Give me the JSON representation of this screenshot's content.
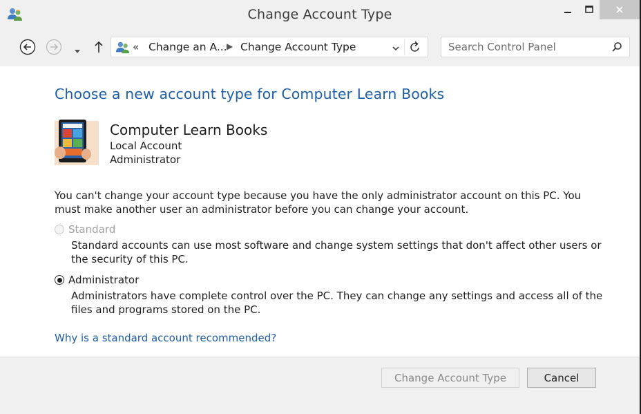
{
  "window": {
    "title": "Change Account Type",
    "app_icon": "users-icon",
    "controls": {
      "minimize": "minimize-icon",
      "maximize": "maximize-icon",
      "close": "close-icon"
    }
  },
  "nav": {
    "back_icon": "back-arrow-icon",
    "forward_icon": "forward-arrow-icon",
    "recent_icon": "chevron-down-icon",
    "up_icon": "up-arrow-icon",
    "breadcrumb_overflow": "«",
    "breadcrumb": [
      "Change an A...",
      "Change Account Type"
    ],
    "search_placeholder": "Search Control Panel"
  },
  "main": {
    "heading": "Choose a new account type for Computer Learn Books",
    "account": {
      "name": "Computer Learn Books",
      "type": "Local Account",
      "role": "Administrator"
    },
    "notice": "You can't change your account type because you have the only administrator account on this PC. You must make another user an administrator before you can change your account.",
    "options": [
      {
        "label": "Standard",
        "description": "Standard accounts can use most software and change system settings that don't affect other users or the security of this PC.",
        "selected": false,
        "enabled": false
      },
      {
        "label": "Administrator",
        "description": "Administrators have complete control over the PC. They can change any settings and access all of the files and programs stored on the PC.",
        "selected": true,
        "enabled": true
      }
    ],
    "help_link": "Why is a standard account recommended?"
  },
  "footer": {
    "change_button": "Change Account Type",
    "cancel_button": "Cancel"
  },
  "colors": {
    "heading": "#1e5fa8",
    "link": "#1e5fa8",
    "disabled_text": "#a0a0a0",
    "close_button_bg": "#c7c7c7"
  }
}
